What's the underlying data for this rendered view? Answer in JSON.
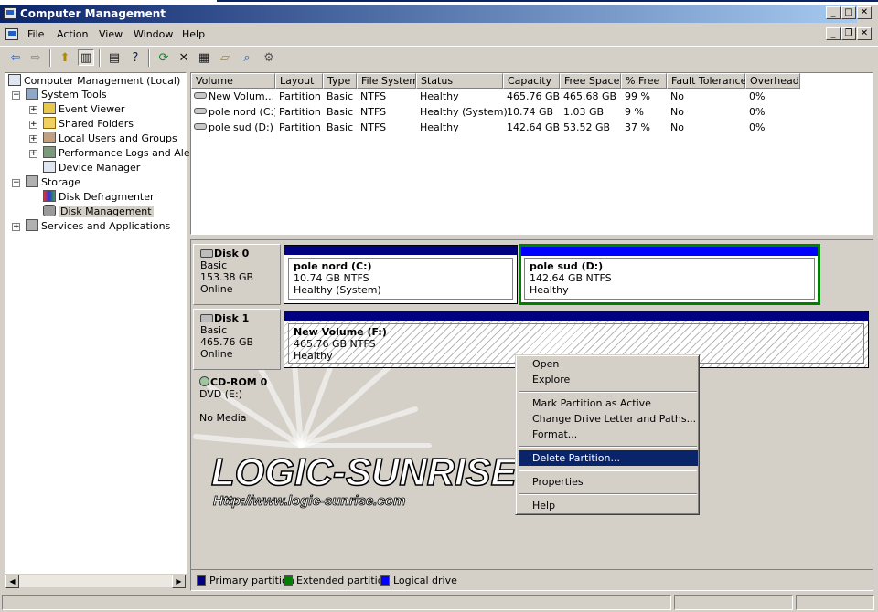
{
  "window": {
    "title": "Computer Management"
  },
  "menu": [
    "File",
    "Action",
    "View",
    "Window",
    "Help"
  ],
  "toolbar_icons": [
    "back-arrow-icon",
    "forward-arrow-icon",
    "up-folder-icon",
    "show-hide-tree-icon",
    "properties-icon",
    "help-icon",
    "refresh-icon",
    "delete-icon",
    "properties-sheet-icon",
    "open-folder-icon",
    "search-icon",
    "settings-icon"
  ],
  "tree": {
    "root": "Computer Management (Local)",
    "system_tools": "System Tools",
    "event_viewer": "Event Viewer",
    "shared_folders": "Shared Folders",
    "local_users": "Local Users and Groups",
    "perf_logs": "Performance Logs and Alerts",
    "device_manager": "Device Manager",
    "storage": "Storage",
    "disk_defrag": "Disk Defragmenter",
    "disk_management": "Disk Management",
    "services": "Services and Applications"
  },
  "volumes": {
    "columns": [
      "Volume",
      "Layout",
      "Type",
      "File System",
      "Status",
      "Capacity",
      "Free Space",
      "% Free",
      "Fault Tolerance",
      "Overhead"
    ],
    "rows": [
      [
        "New Volum...",
        "Partition",
        "Basic",
        "NTFS",
        "Healthy",
        "465.76 GB",
        "465.68 GB",
        "99 %",
        "No",
        "0%"
      ],
      [
        "pole nord (C:)",
        "Partition",
        "Basic",
        "NTFS",
        "Healthy (System)",
        "10.74 GB",
        "1.03 GB",
        "9 %",
        "No",
        "0%"
      ],
      [
        "pole sud (D:)",
        "Partition",
        "Basic",
        "NTFS",
        "Healthy",
        "142.64 GB",
        "53.52 GB",
        "37 %",
        "No",
        "0%"
      ]
    ]
  },
  "disks": {
    "disk0": {
      "name": "Disk 0",
      "type": "Basic",
      "size": "153.38 GB",
      "status": "Online"
    },
    "disk1": {
      "name": "Disk 1",
      "type": "Basic",
      "size": "465.76 GB",
      "status": "Online"
    },
    "cdrom": {
      "name": "CD-ROM 0",
      "type": "DVD (E:)",
      "status": "No Media"
    }
  },
  "partitions": {
    "c": {
      "name": "pole nord  (C:)",
      "size": "10.74 GB NTFS",
      "status": "Healthy (System)"
    },
    "d": {
      "name": "pole sud  (D:)",
      "size": "142.64 GB NTFS",
      "status": "Healthy"
    },
    "f": {
      "name": "New Volume  (F:)",
      "size": "465.76 GB NTFS",
      "status": "Healthy"
    }
  },
  "watermark": {
    "brand": "LOGIC-SUNRISE",
    "url": "Http://www.logic-sunrise.com"
  },
  "context_menu": {
    "open": "Open",
    "explore": "Explore",
    "mark_active": "Mark Partition as Active",
    "change_letter": "Change Drive Letter and Paths...",
    "format": "Format...",
    "delete": "Delete Partition...",
    "properties": "Properties",
    "help": "Help"
  },
  "legend": [
    {
      "label": "Primary partition",
      "color": "#000080"
    },
    {
      "label": "Extended partition",
      "color": "#008000"
    },
    {
      "label": "Logical drive",
      "color": "#0000ff"
    }
  ],
  "colors": {
    "primary": "#000080",
    "extended": "#008000",
    "logical": "#0000ff",
    "highlight": "#0a246a"
  }
}
